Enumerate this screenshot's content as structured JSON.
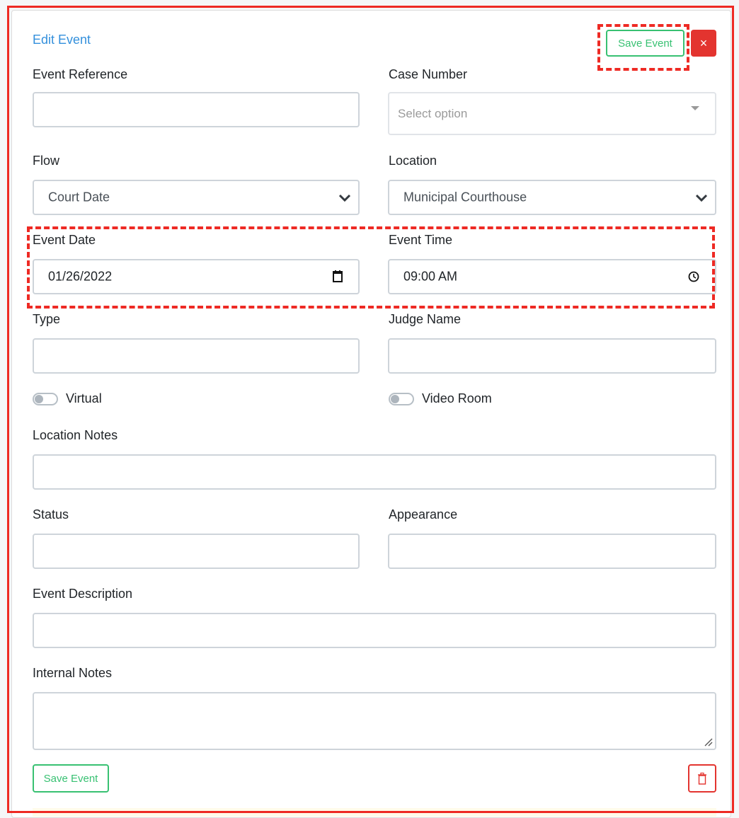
{
  "header": {
    "title": "Edit Event",
    "save_label": "Save Event",
    "close_icon": "×"
  },
  "fields": {
    "event_reference": {
      "label": "Event Reference",
      "value": ""
    },
    "case_number": {
      "label": "Case Number",
      "placeholder": "Select option",
      "value": ""
    },
    "flow": {
      "label": "Flow",
      "value": "Court Date"
    },
    "location": {
      "label": "Location",
      "value": "Municipal Courthouse"
    },
    "event_date": {
      "label": "Event Date",
      "value": "01/26/2022"
    },
    "event_time": {
      "label": "Event Time",
      "value": "09:00 AM"
    },
    "type": {
      "label": "Type",
      "value": ""
    },
    "judge_name": {
      "label": "Judge Name",
      "value": ""
    },
    "location_notes": {
      "label": "Location Notes",
      "value": ""
    },
    "status": {
      "label": "Status",
      "value": ""
    },
    "appearance": {
      "label": "Appearance",
      "value": ""
    },
    "event_description": {
      "label": "Event Description",
      "value": ""
    },
    "internal_notes": {
      "label": "Internal Notes",
      "value": ""
    }
  },
  "toggles": {
    "virtual": {
      "label": "Virtual",
      "checked": false
    },
    "video_room": {
      "label": "Video Room",
      "checked": false
    }
  },
  "footer": {
    "save_label": "Save Event",
    "delete_icon": "trash-icon"
  },
  "colors": {
    "accent_blue": "#3490dc",
    "success_green": "#38c172",
    "danger_red": "#e3342f",
    "highlight_red": "#ee2a24"
  }
}
